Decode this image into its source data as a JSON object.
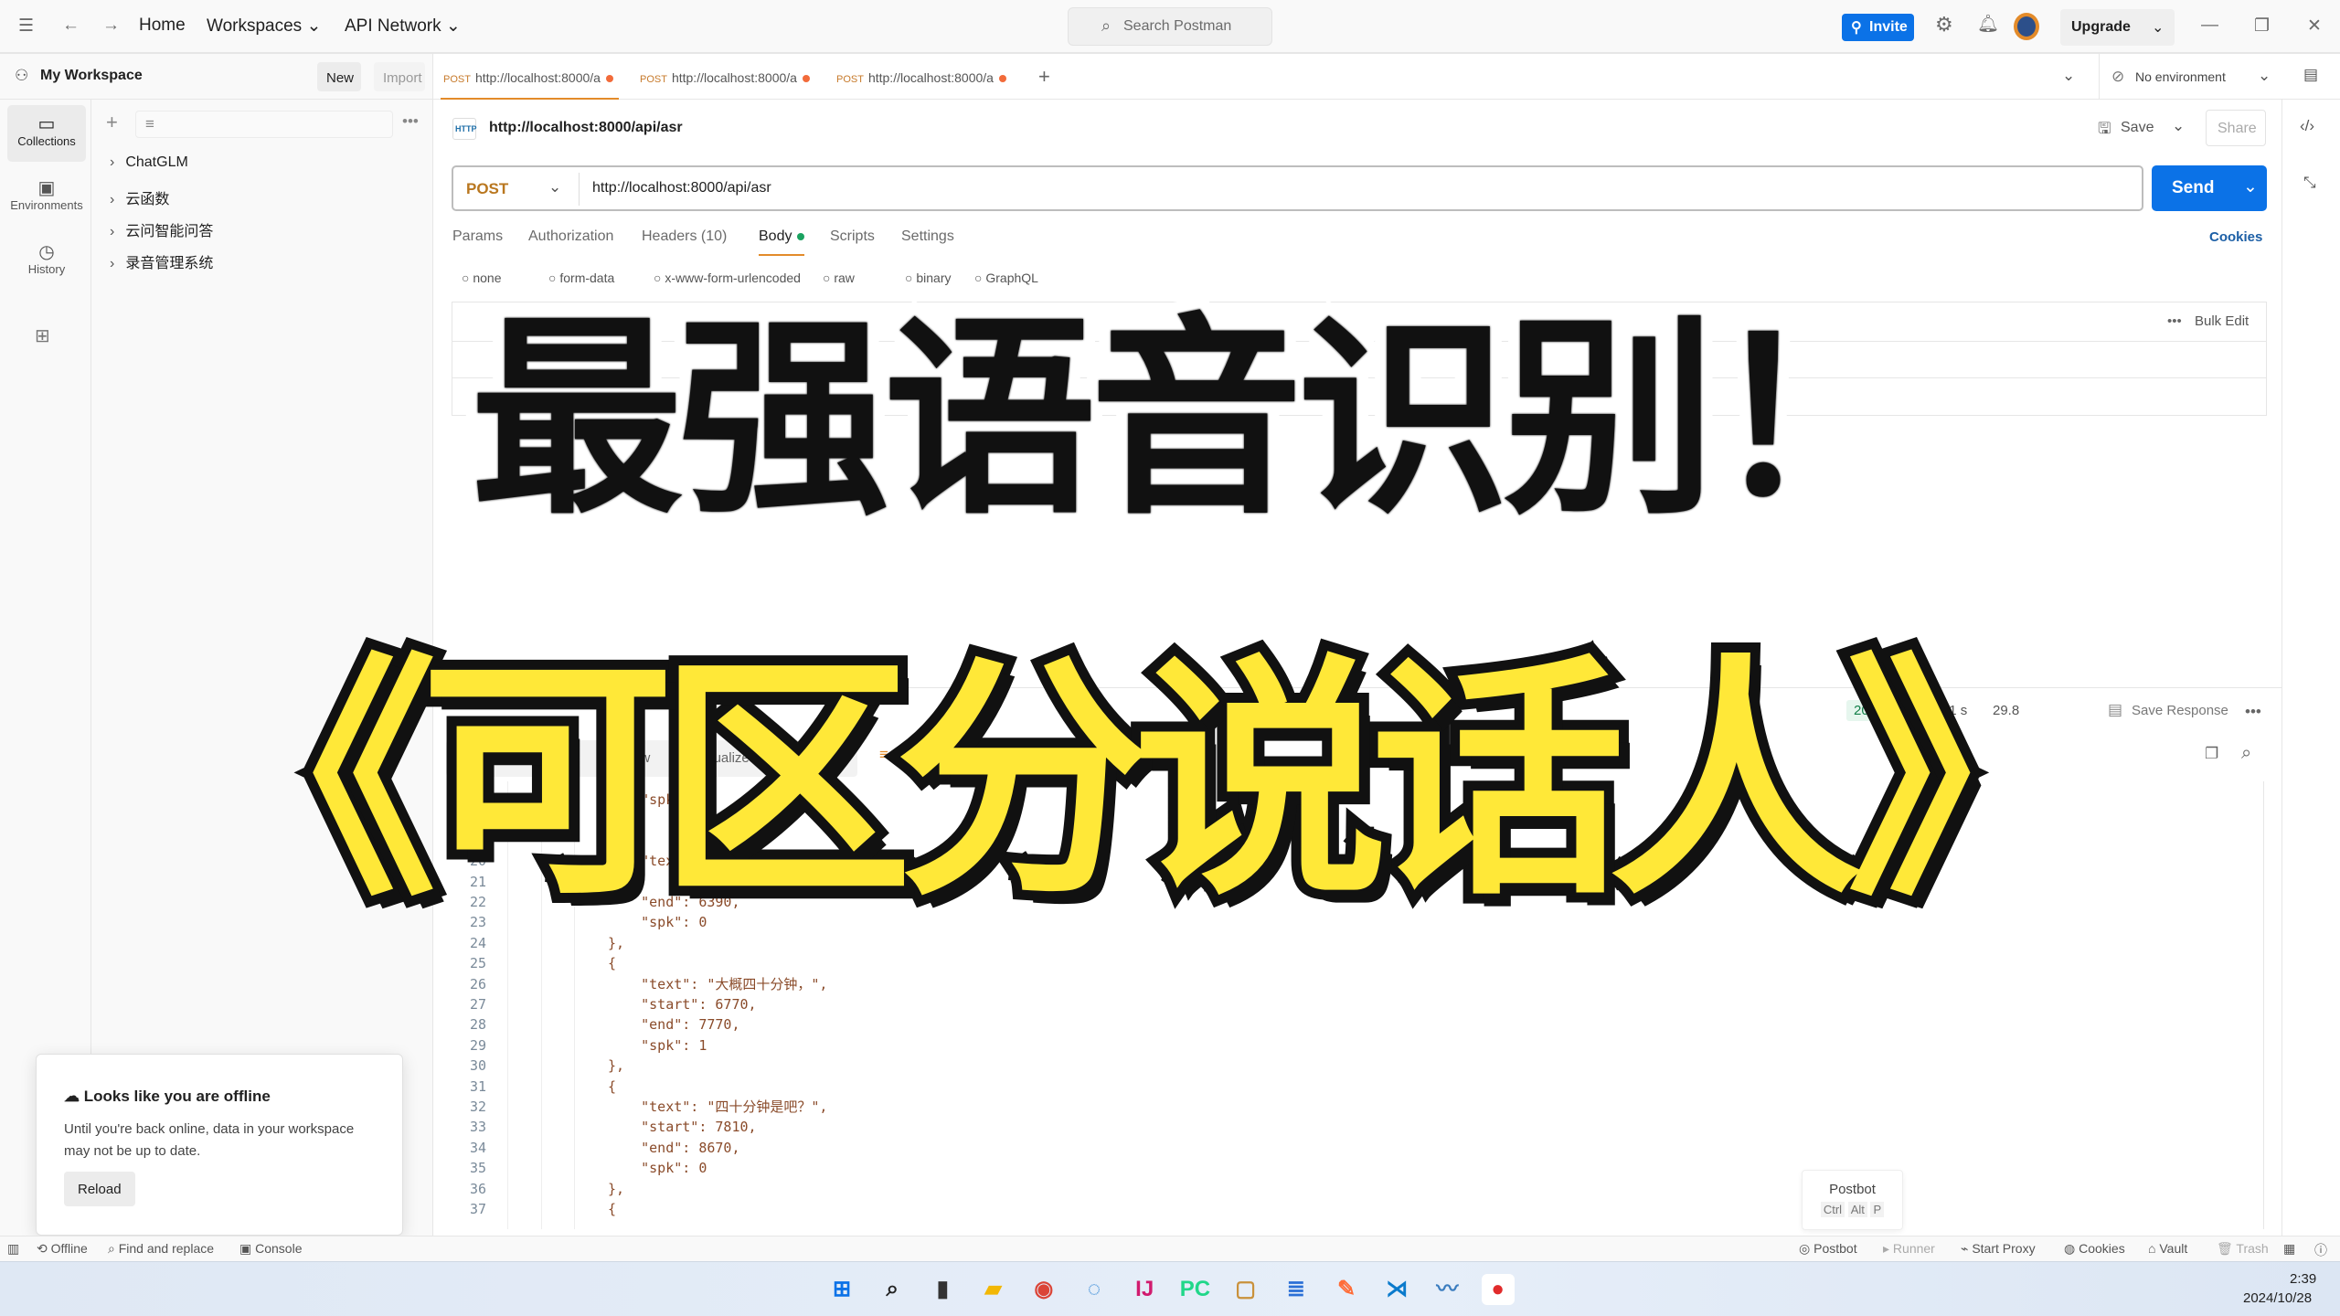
{
  "titlebar": {
    "home": "Home",
    "workspaces": "Workspaces",
    "api_network": "API Network",
    "search_placeholder": "Search Postman",
    "invite": "Invite",
    "upgrade": "Upgrade"
  },
  "workspace": {
    "name": "My Workspace",
    "new": "New",
    "import": "Import"
  },
  "tabs": [
    {
      "method": "POST",
      "label": "http://localhost:8000/a"
    },
    {
      "method": "POST",
      "label": "http://localhost:8000/a"
    },
    {
      "method": "POST",
      "label": "http://localhost:8000/a"
    }
  ],
  "environment": "No environment",
  "rail": [
    {
      "label": "Collections",
      "icon": "collections-icon"
    },
    {
      "label": "Environments",
      "icon": "environments-icon"
    },
    {
      "label": "History",
      "icon": "history-icon"
    }
  ],
  "collections": [
    "ChatGLM",
    "云函数",
    "云问智能问答",
    "录音管理系统"
  ],
  "request": {
    "title": "http://localhost:8000/api/asr",
    "save": "Save",
    "share": "Share",
    "method": "POST",
    "url": "http://localhost:8000/api/asr",
    "send": "Send",
    "cookies": "Cookies",
    "tabs": [
      "Params",
      "Authorization",
      "Headers (10)",
      "Body",
      "Scripts",
      "Settings"
    ],
    "body_types": [
      "none",
      "form-data",
      "x-www-form-urlencoded",
      "raw",
      "binary",
      "GraphQL"
    ],
    "bulk_edit": "Bulk Edit"
  },
  "response": {
    "status": "200 OK",
    "time": "35.91 s",
    "size": "29.8",
    "save_response": "Save Response",
    "views": [
      "Pretty",
      "Raw",
      "Preview",
      "Visualize"
    ],
    "lines": [
      {
        "n": "17",
        "t": "    \"spk\": 0"
      },
      {
        "n": "18",
        "t": "},"
      },
      {
        "n": "19",
        "t": "{"
      },
      {
        "n": "20",
        "t": "    \"text\": \"那个……\","
      },
      {
        "n": "21",
        "t": ""
      },
      {
        "n": "22",
        "t": "    \"end\": 6390,"
      },
      {
        "n": "23",
        "t": "    \"spk\": 0"
      },
      {
        "n": "24",
        "t": "},"
      },
      {
        "n": "25",
        "t": "{"
      },
      {
        "n": "26",
        "t": "    \"text\": \"大概四十分钟，\","
      },
      {
        "n": "27",
        "t": "    \"start\": 6770,"
      },
      {
        "n": "28",
        "t": "    \"end\": 7770,"
      },
      {
        "n": "29",
        "t": "    \"spk\": 1"
      },
      {
        "n": "30",
        "t": "},"
      },
      {
        "n": "31",
        "t": "{"
      },
      {
        "n": "32",
        "t": "    \"text\": \"四十分钟是吧？\","
      },
      {
        "n": "33",
        "t": "    \"start\": 7810,"
      },
      {
        "n": "34",
        "t": "    \"end\": 8670,"
      },
      {
        "n": "35",
        "t": "    \"spk\": 0"
      },
      {
        "n": "36",
        "t": "},"
      },
      {
        "n": "37",
        "t": "{"
      }
    ]
  },
  "toast": {
    "title": "Looks like you are offline",
    "body": "Until you're back online, data in your workspace may not be up to date.",
    "reload": "Reload"
  },
  "postbot": {
    "label": "Postbot",
    "keys": [
      "Ctrl",
      "Alt",
      "P"
    ]
  },
  "statusbar": {
    "left": [
      "Offline",
      "Find and replace",
      "Console"
    ],
    "right": [
      "Postbot",
      "Runner",
      "Start Proxy",
      "Cookies",
      "Vault",
      "Trash"
    ]
  },
  "taskbar": {
    "time": "2:39",
    "date": "2024/10/28",
    "apps": [
      "start",
      "search",
      "task-view",
      "file-explorer",
      "chrome",
      "app",
      "intellij",
      "pycharm",
      "notes",
      "notepad",
      "postman",
      "vscode",
      "task-manager",
      "recorder"
    ]
  },
  "overlay": {
    "line1": "最强语音识别！",
    "line2": "《可区分说话人》"
  },
  "colors": {
    "accent": "#0b72e7",
    "tab_dot": "#f26b3a",
    "overlay_yellow": "#ffe838"
  }
}
